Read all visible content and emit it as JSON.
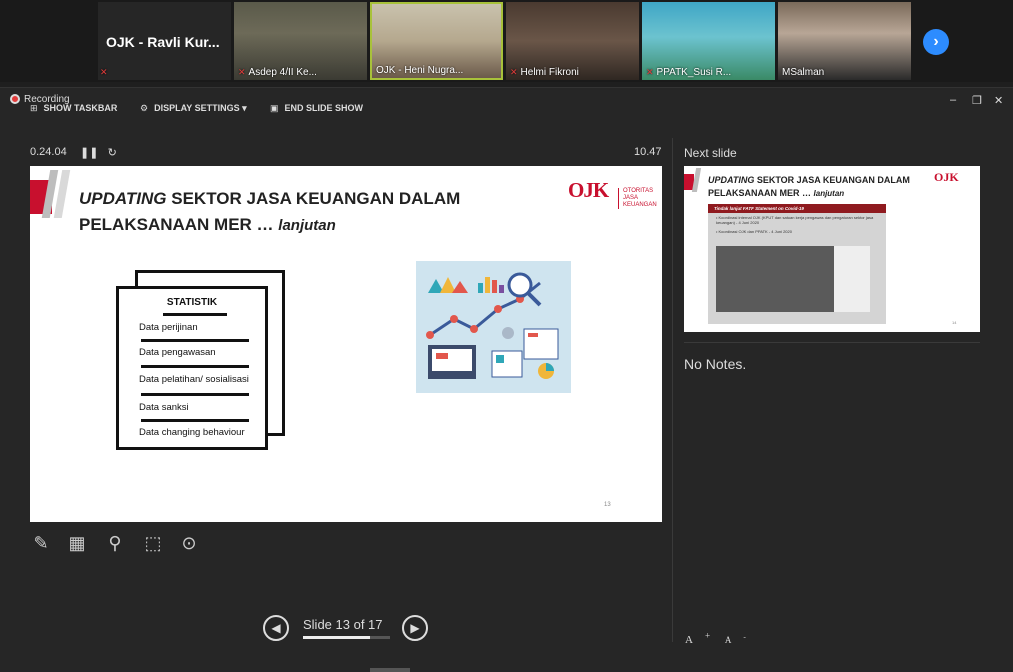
{
  "participants": {
    "first": {
      "big_name": "OJK - Ravli Kur...",
      "label": ""
    },
    "tiles": [
      {
        "name": "Asdep 4/II Ke...",
        "muted": true
      },
      {
        "name": "OJK - Heni Nugra...",
        "muted": false
      },
      {
        "name": "Helmi Fikroni",
        "muted": true
      },
      {
        "name": "PPATK_Susi R...",
        "muted": true
      },
      {
        "name": "MSalman",
        "muted": false
      }
    ],
    "next_icon": "chevron-right-icon"
  },
  "window": {
    "recording_label": "Recording",
    "toolbar": {
      "show_taskbar": "SHOW TASKBAR",
      "display_settings": "DISPLAY SETTINGS ▾",
      "end_slide_show": "END SLIDE SHOW"
    }
  },
  "timer": {
    "elapsed": "0.24.04",
    "pause_icon": "pause-icon",
    "reset_icon": "reset-icon",
    "clock": "10.47"
  },
  "slide": {
    "title_italic": "UPDATING",
    "title_rest": " SEKTOR JASA KEUANGAN DALAM",
    "title_line2": "PELAKSANAAN MER … ",
    "title_suffix": "lanjutan",
    "logo_text": "OJK",
    "logo_sub": [
      "OTORITAS",
      "JASA",
      "KEUANGAN"
    ],
    "doc_title": "STATISTIK",
    "doc_items": [
      "Data perijinan",
      "Data pengawasan",
      "Data pelatihan/ sosialisasi",
      "Data sanksi",
      "Data changing behaviour"
    ],
    "page_number": "13",
    "colors": {
      "accent_red": "#c8102e"
    }
  },
  "tools": [
    "pen-icon",
    "slides-grid-icon",
    "zoom-icon",
    "screen-pointer-icon",
    "more-icon"
  ],
  "navigation": {
    "counter": "Slide 13 of 17",
    "current": 13,
    "total": 17,
    "progress_fraction": 0.765
  },
  "next_slide": {
    "label": "Next slide",
    "title_italic": "UPDATING",
    "title_rest": " SEKTOR JASA KEUANGAN DALAM",
    "title_line2": "PELAKSANAAN MER … ",
    "title_suffix": "lanjutan",
    "logo_text": "OJK",
    "box_head": "Tindak lanjut FATF Statement on Covid-19",
    "bullets": [
      "Koordinasi internal OJK (KPUT dan satuan kerja pengawas dan pengaturan sektor jasa keuangan) - 4 Juni 2020",
      "Koordinasi OJK dan PPATK - 4 Juni 2020"
    ],
    "page_number": "14"
  },
  "notes": {
    "text": "No Notes."
  },
  "font_controls": {
    "increase": "A",
    "decrease": "A"
  }
}
